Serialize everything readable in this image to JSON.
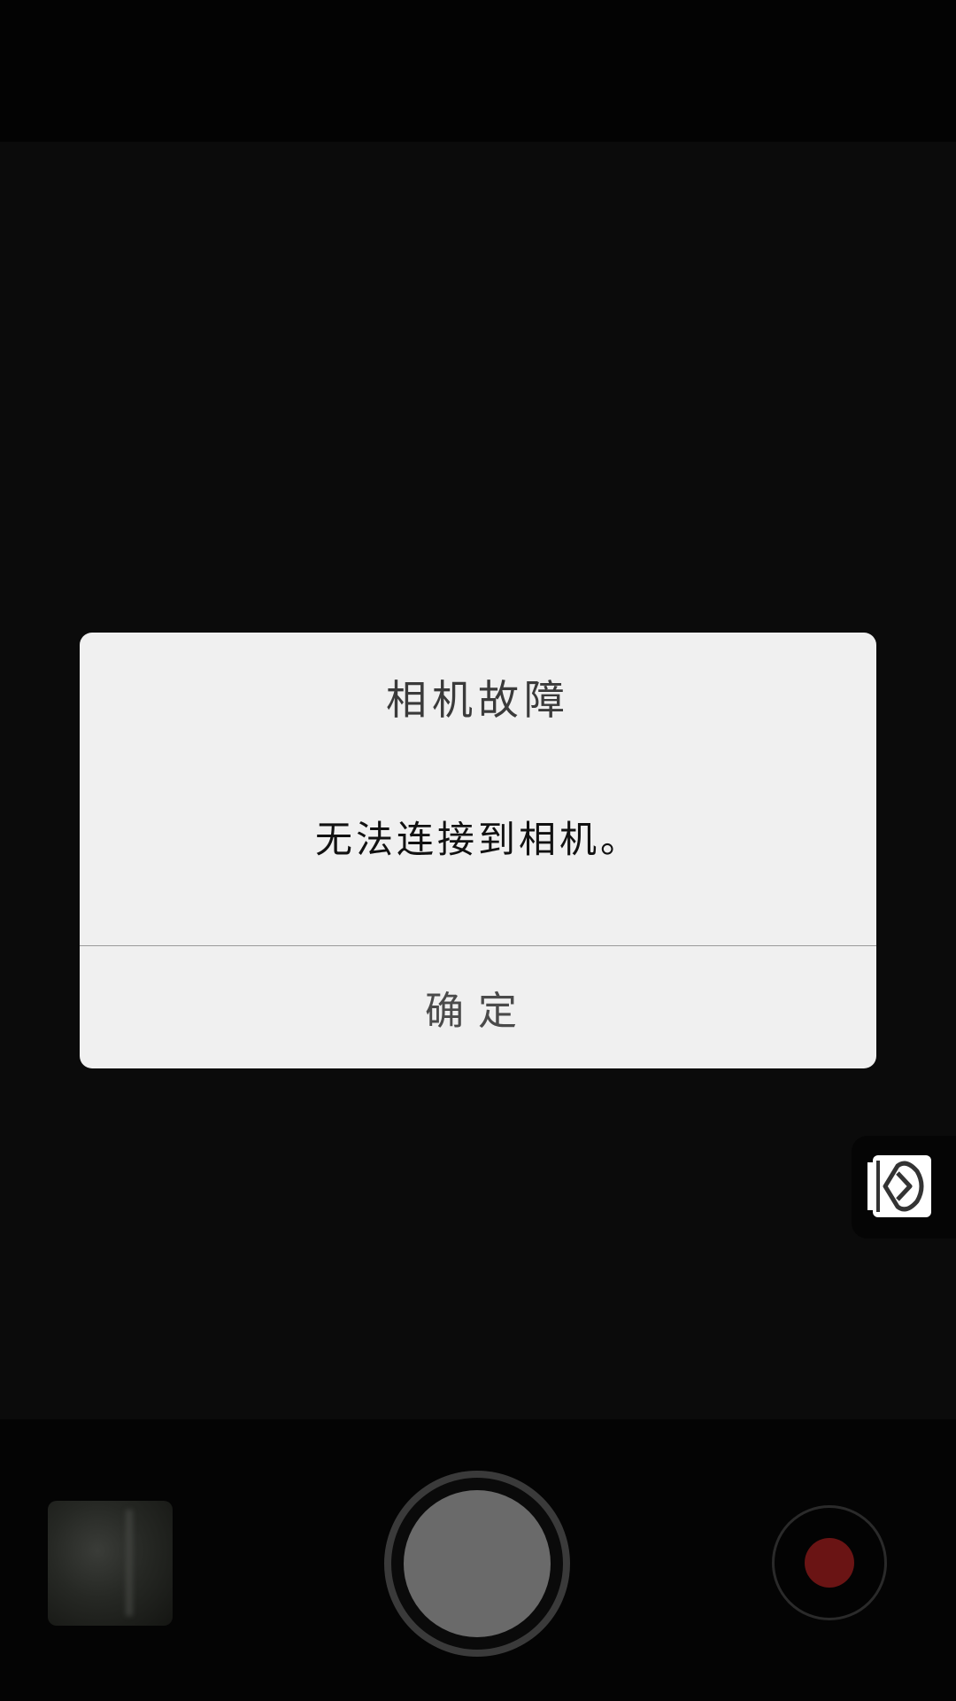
{
  "dialog": {
    "title": "相机故障",
    "message": "无法连接到相机。",
    "ok_label": "确定"
  },
  "side_widget": {
    "icon": "floating-play-icon"
  },
  "controls": {
    "gallery_icon": "gallery-thumbnail",
    "shutter_icon": "shutter-icon",
    "record_icon": "record-icon"
  },
  "colors": {
    "background": "#0b0b0b",
    "dialog_bg": "#f0f0f0",
    "record_dot": "#6a1414",
    "shutter": "#6a6a6a"
  }
}
